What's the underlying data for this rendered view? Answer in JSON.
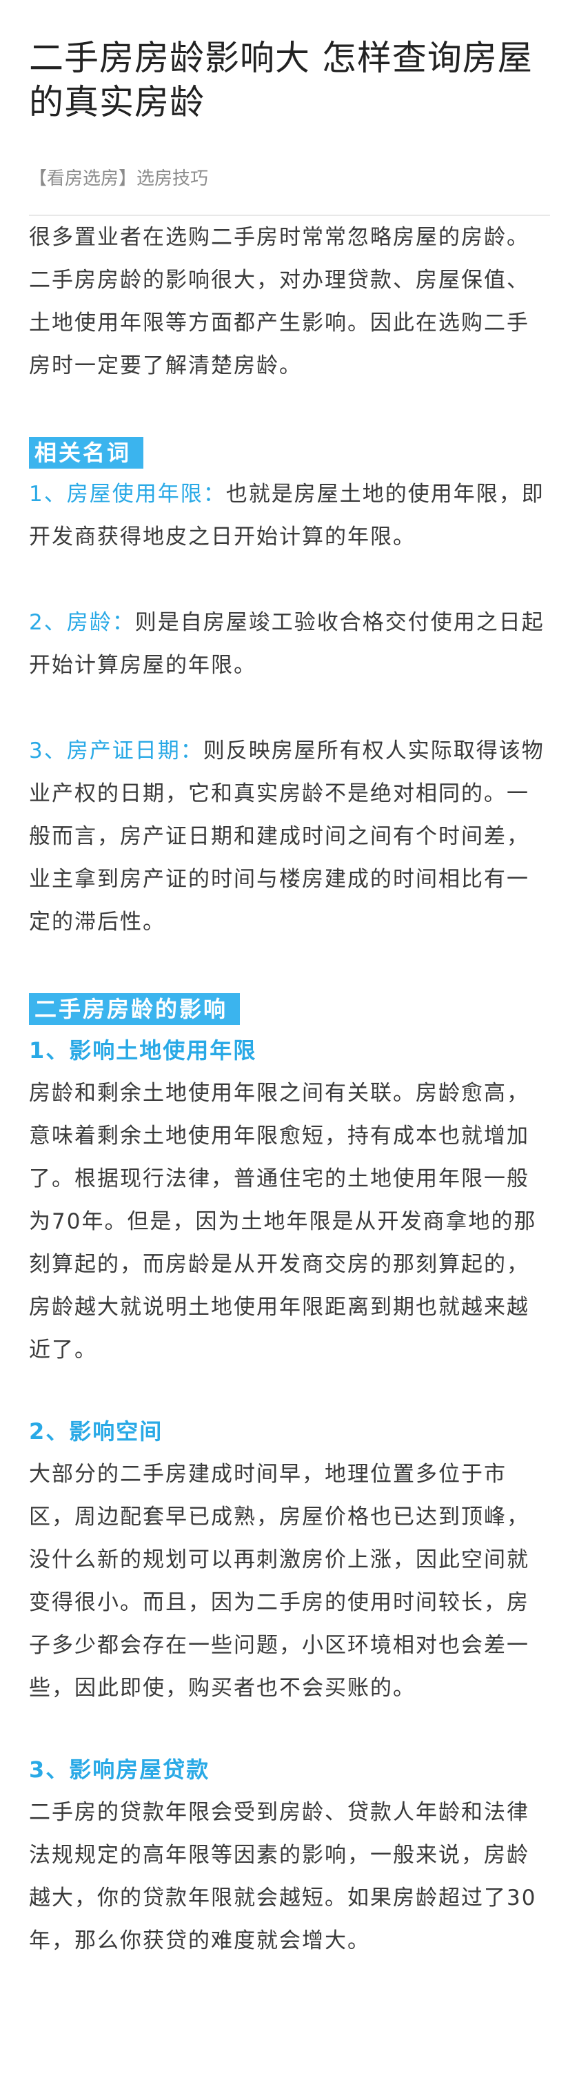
{
  "article": {
    "title": "二手房房龄影响大 怎样查询房屋的真实房龄",
    "meta": "【看房选房】选房技巧",
    "intro": "很多置业者在选购二手房时常常忽略房屋的房龄。二手房房龄的影响很大，对办理贷款、房屋保值、土地使用年限等方面都产生影响。因此在选购二手房时一定要了解清楚房龄。"
  },
  "section1": {
    "tag": "相关名词",
    "items": [
      {
        "label": "1、房屋使用年限：",
        "text": "也就是房屋土地的使用年限，即开发商获得地皮之日开始计算的年限。"
      },
      {
        "label": "2、房龄：",
        "text": "则是自房屋竣工验收合格交付使用之日起开始计算房屋的年限。"
      },
      {
        "label": "3、房产证日期：",
        "text": "则反映房屋所有权人实际取得该物业产权的日期，它和真实房龄不是绝对相同的。一般而言，房产证日期和建成时间之间有个时间差，业主拿到房产证的时间与楼房建成的时间相比有一定的滞后性。"
      }
    ]
  },
  "section2": {
    "tag": "二手房房龄的影响",
    "subsections": [
      {
        "heading": "1、影响土地使用年限",
        "text": "房龄和剩余土地使用年限之间有关联。房龄愈高，意味着剩余土地使用年限愈短，持有成本也就增加了。根据现行法律，普通住宅的土地使用年限一般为70年。但是，因为土地年限是从开发商拿地的那刻算起的，而房龄是从开发商交房的那刻算起的，房龄越大就说明土地使用年限距离到期也就越来越近了。"
      },
      {
        "heading": "2、影响空间",
        "text": "大部分的二手房建成时间早，地理位置多位于市区，周边配套早已成熟，房屋价格也已达到顶峰，没什么新的规划可以再刺激房价上涨，因此空间就变得很小。而且，因为二手房的使用时间较长，房子多少都会存在一些问题，小区环境相对也会差一些，因此即使，购买者也不会买账的。"
      },
      {
        "heading": "3、影响房屋贷款",
        "text": "二手房的贷款年限会受到房龄、贷款人年龄和法律法规规定的高年限等因素的影响，一般来说，房龄越大，你的贷款年限就会越短。如果房龄超过了30年，那么你获贷的难度就会增大。"
      }
    ]
  },
  "colors": {
    "accent": "#29a9e6",
    "tag_bg": "#3bb4ee",
    "text": "#3a3a3a",
    "meta": "#8c8c8c"
  }
}
